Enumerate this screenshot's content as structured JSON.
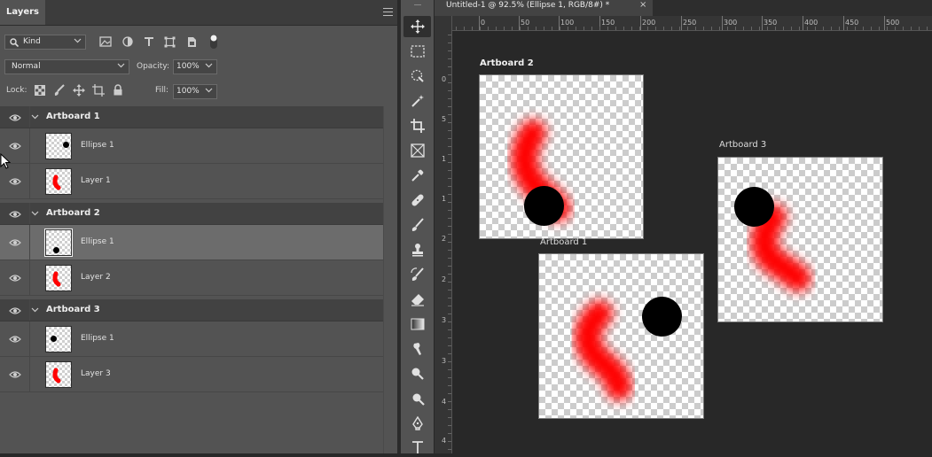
{
  "layers_panel": {
    "tab_label": "Layers",
    "filter_kind": "Kind",
    "blend_mode": "Normal",
    "opacity_label": "Opacity:",
    "opacity_value": "100%",
    "lock_label": "Lock:",
    "fill_label": "Fill:",
    "fill_value": "100%",
    "groups": [
      {
        "name": "Artboard 1",
        "layers": [
          {
            "name": "Ellipse 1"
          },
          {
            "name": "Layer 1"
          }
        ]
      },
      {
        "name": "Artboard 2",
        "layers": [
          {
            "name": "Ellipse 1",
            "selected": true
          },
          {
            "name": "Layer 2"
          }
        ]
      },
      {
        "name": "Artboard 3",
        "layers": [
          {
            "name": "Ellipse 1"
          },
          {
            "name": "Layer 3"
          }
        ]
      }
    ]
  },
  "document": {
    "tab_title": "Untitled-1 @ 92.5% (Ellipse 1, RGB/8#) *",
    "close_glyph": "×",
    "ruler_h": [
      "0",
      "50",
      "100",
      "150",
      "200",
      "250",
      "300",
      "350",
      "400",
      "450",
      "500"
    ],
    "ruler_v": [
      "0",
      "5",
      "1",
      "1",
      "2",
      "2",
      "3",
      "3",
      "4",
      "4"
    ],
    "artboards": [
      {
        "label": "Artboard 2"
      },
      {
        "label": "Artboard 1"
      },
      {
        "label": "Artboard 3"
      }
    ]
  },
  "colors": {
    "accent_red": "#ff0000",
    "ellipse": "#000000"
  },
  "toolbar": {
    "tools": [
      "move-tool",
      "marquee-tool",
      "lasso-tool",
      "magic-wand-tool",
      "crop-tool",
      "frame-tool",
      "eyedropper-tool",
      "healing-tool",
      "brush-tool",
      "stamp-tool",
      "history-brush-tool",
      "eraser-tool",
      "gradient-tool",
      "smudge-tool",
      "dodge-tool",
      "zoom-tool",
      "pen-tool",
      "type-tool"
    ]
  }
}
